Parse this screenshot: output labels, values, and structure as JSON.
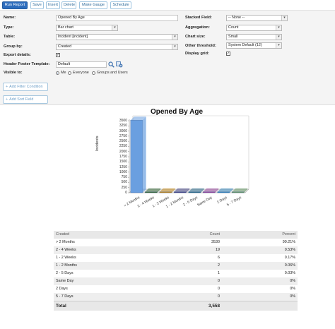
{
  "toolbar": {
    "run_report": "Run Report",
    "save": "Save",
    "insert": "Insert",
    "delete": "Delete",
    "make_gauge": "Make Gauge",
    "schedule": "Schedule"
  },
  "form": {
    "name_label": "Name:",
    "name_value": "Opened By Age",
    "type_label": "Type:",
    "type_value": "Bar chart",
    "table_label": "Table:",
    "table_value": "Incident [incident]",
    "group_by_label": "Group by:",
    "group_by_value": "Created",
    "export_details_label": "Export details:",
    "export_details_checked": true,
    "header_footer_label": "Header Footer Template:",
    "header_footer_value": "Default",
    "visible_to_label": "Visible to:",
    "visible_options": [
      "Me",
      "Everyone",
      "Groups and Users"
    ],
    "visible_selected": "Me",
    "stacked_field_label": "Stacked Field:",
    "stacked_field_value": "-- None --",
    "aggregation_label": "Aggregation:",
    "aggregation_value": "Count",
    "chart_size_label": "Chart size:",
    "chart_size_value": "Small",
    "other_threshold_label": "Other threshold:",
    "other_threshold_value": "System Default (12)",
    "display_grid_label": "Display grid:",
    "display_grid_checked": true,
    "add_filter_label": "Add Filter Condition",
    "add_sort_label": "Add Sort Field",
    "check_mark": "✓",
    "plus": "+",
    "caret": "▾"
  },
  "chart_data": {
    "type": "bar",
    "title": "Opened By Age",
    "ylabel": "Incidents",
    "xlabel": "",
    "categories": [
      "> 2 Months",
      "2 - 4 Weeks",
      "1 - 2 Weeks",
      "1 - 2 Months",
      "2 - 5 Days",
      "Same Day",
      "2 Days",
      "5 - 7 Days"
    ],
    "values": [
      3530,
      19,
      6,
      2,
      1,
      0,
      0,
      0
    ],
    "ylim": [
      0,
      3500
    ],
    "yticks": [
      0,
      250,
      500,
      750,
      1000,
      1250,
      1500,
      1750,
      2000,
      2250,
      2500,
      2750,
      3000,
      3250,
      3500
    ],
    "grid": false,
    "colors": [
      "#6a9fe0",
      "#3a6b3a",
      "#c48a1e",
      "#4a4a8a",
      "#2e6e8e",
      "#9a4aa0",
      "#3a8ac0",
      "#6a9a6a"
    ]
  },
  "table": {
    "headers": [
      "Created",
      "Count",
      "Percent"
    ],
    "rows": [
      [
        "> 2 Months",
        "3530",
        "99.21%"
      ],
      [
        "2 - 4 Weeks",
        "19",
        "0.53%"
      ],
      [
        "1 - 2 Weeks",
        "6",
        "0.17%"
      ],
      [
        "1 - 2 Months",
        "2",
        "0.06%"
      ],
      [
        "2 - 5 Days",
        "1",
        "0.03%"
      ],
      [
        "Same Day",
        "0",
        "0%"
      ],
      [
        "2 Days",
        "0",
        "0%"
      ],
      [
        "5 - 7 Days",
        "0",
        "0%"
      ]
    ],
    "total_label": "Total",
    "total_value": "3,558"
  }
}
